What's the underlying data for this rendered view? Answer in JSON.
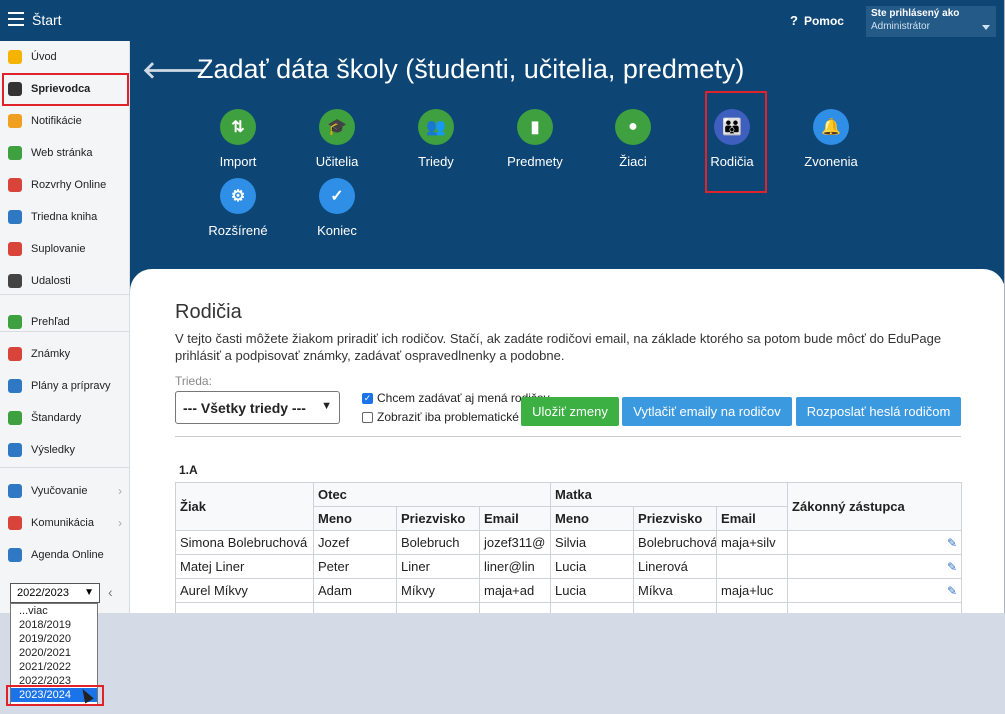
{
  "topbar": {
    "title": "Štart",
    "help": "Pomoc",
    "user_line1": "Ste prihlásený ako",
    "user_line2": "Administrátor"
  },
  "sidebar": {
    "items": [
      {
        "label": "Úvod",
        "icon": "star-icon",
        "color": "#f4b400"
      },
      {
        "label": "Sprievodca",
        "icon": "magic-wand-icon",
        "color": "#333333"
      },
      {
        "label": "Notifikácie",
        "icon": "envelope-icon",
        "color": "#f0a020"
      },
      {
        "label": "Web stránka",
        "icon": "home-icon",
        "color": "#3ea03e"
      },
      {
        "label": "Rozvrhy Online",
        "icon": "calendar-grid-icon",
        "color": "#d9443a"
      },
      {
        "label": "Triedna kniha",
        "icon": "book-icon",
        "color": "#2f78c4"
      },
      {
        "label": "Suplovanie",
        "icon": "person-swap-icon",
        "color": "#d9443a"
      },
      {
        "label": "Udalosti",
        "icon": "calendar-icon",
        "color": "#444444"
      },
      {
        "label": "Prehľad",
        "icon": "check-circle-icon",
        "color": "#3ea03e"
      },
      {
        "label": "Známky",
        "icon": "grades-icon",
        "color": "#d9443a"
      },
      {
        "label": "Plány a prípravy",
        "icon": "briefcase-icon",
        "color": "#2f78c4"
      },
      {
        "label": "Štandardy",
        "icon": "shield-check-icon",
        "color": "#3ea03e"
      },
      {
        "label": "Výsledky",
        "icon": "bar-chart-icon",
        "color": "#2f78c4"
      },
      {
        "label": "Vyučovanie",
        "icon": "open-book-icon",
        "color": "#2f78c4"
      },
      {
        "label": "Komunikácia",
        "icon": "chat-icon",
        "color": "#d9443a"
      },
      {
        "label": "Agenda Online",
        "icon": "pen-icon",
        "color": "#2f78c4"
      }
    ],
    "year_selected": "2022/2023",
    "year_options": [
      "...viac",
      "2018/2019",
      "2019/2020",
      "2020/2021",
      "2021/2022",
      "2022/2023",
      "2023/2024"
    ]
  },
  "main": {
    "title": "Zadať dáta školy (študenti, učitelia, predmety)",
    "steps": [
      {
        "label": "Import",
        "icon": "import-arrows-icon",
        "glyph": "⇅",
        "style": "green"
      },
      {
        "label": "Učitelia",
        "icon": "graduation-cap-icon",
        "glyph": "🎓",
        "style": "green"
      },
      {
        "label": "Triedy",
        "icon": "group-icon",
        "glyph": "👥",
        "style": "green"
      },
      {
        "label": "Predmety",
        "icon": "notebook-icon",
        "glyph": "▮",
        "style": "green"
      },
      {
        "label": "Žiaci",
        "icon": "student-icon",
        "glyph": "●",
        "style": "green"
      },
      {
        "label": "Rodičia",
        "icon": "parents-icon",
        "glyph": "👪",
        "style": "active"
      },
      {
        "label": "Zvonenia",
        "icon": "bell-icon",
        "glyph": "🔔",
        "style": "blue"
      },
      {
        "label": "Rozšírené",
        "icon": "gear-icon",
        "glyph": "⚙",
        "style": "blue"
      },
      {
        "label": "Koniec",
        "icon": "check-icon",
        "glyph": "✓",
        "style": "blue"
      }
    ]
  },
  "content": {
    "heading": "Rodičia",
    "description": "V tejto časti môžete žiakom priradiť ich rodičov. Stačí, ak zadáte rodičovi email, na základe ktorého sa potom bude môcť do EduPage prihlásiť a podpisovať známky, zadávať ospravedlnenky a podobne.",
    "class_label": "Trieda:",
    "class_value": "--- Všetky triedy ---",
    "checkbox1": "Chcem zadávať aj mená rodičov",
    "checkbox2": "Zobraziť iba problematické",
    "btn_save": "Uložiť zmeny",
    "btn_print": "Vytlačiť emaily na rodičov",
    "btn_send": "Rozposlať heslá rodičom",
    "class_name": "1.A",
    "table": {
      "h_student": "Žiak",
      "h_father": "Otec",
      "h_mother": "Matka",
      "h_guardian": "Zákonný zástupca",
      "h_name": "Meno",
      "h_surname": "Priezvisko",
      "h_email": "Email",
      "rows": [
        [
          "Simona Bolebruchová",
          "Jozef",
          "Bolebruch",
          "jozef311@",
          "Silvia",
          "Bolebruchová",
          "maja+silv"
        ],
        [
          "Matej Liner",
          "Peter",
          "Liner",
          "liner@lin",
          "Lucia",
          "Linerová",
          ""
        ],
        [
          "Aurel Míkvy",
          "Adam",
          "Míkvy",
          "maja+ad",
          "Lucia",
          "Míkva",
          "maja+luc"
        ]
      ]
    }
  }
}
